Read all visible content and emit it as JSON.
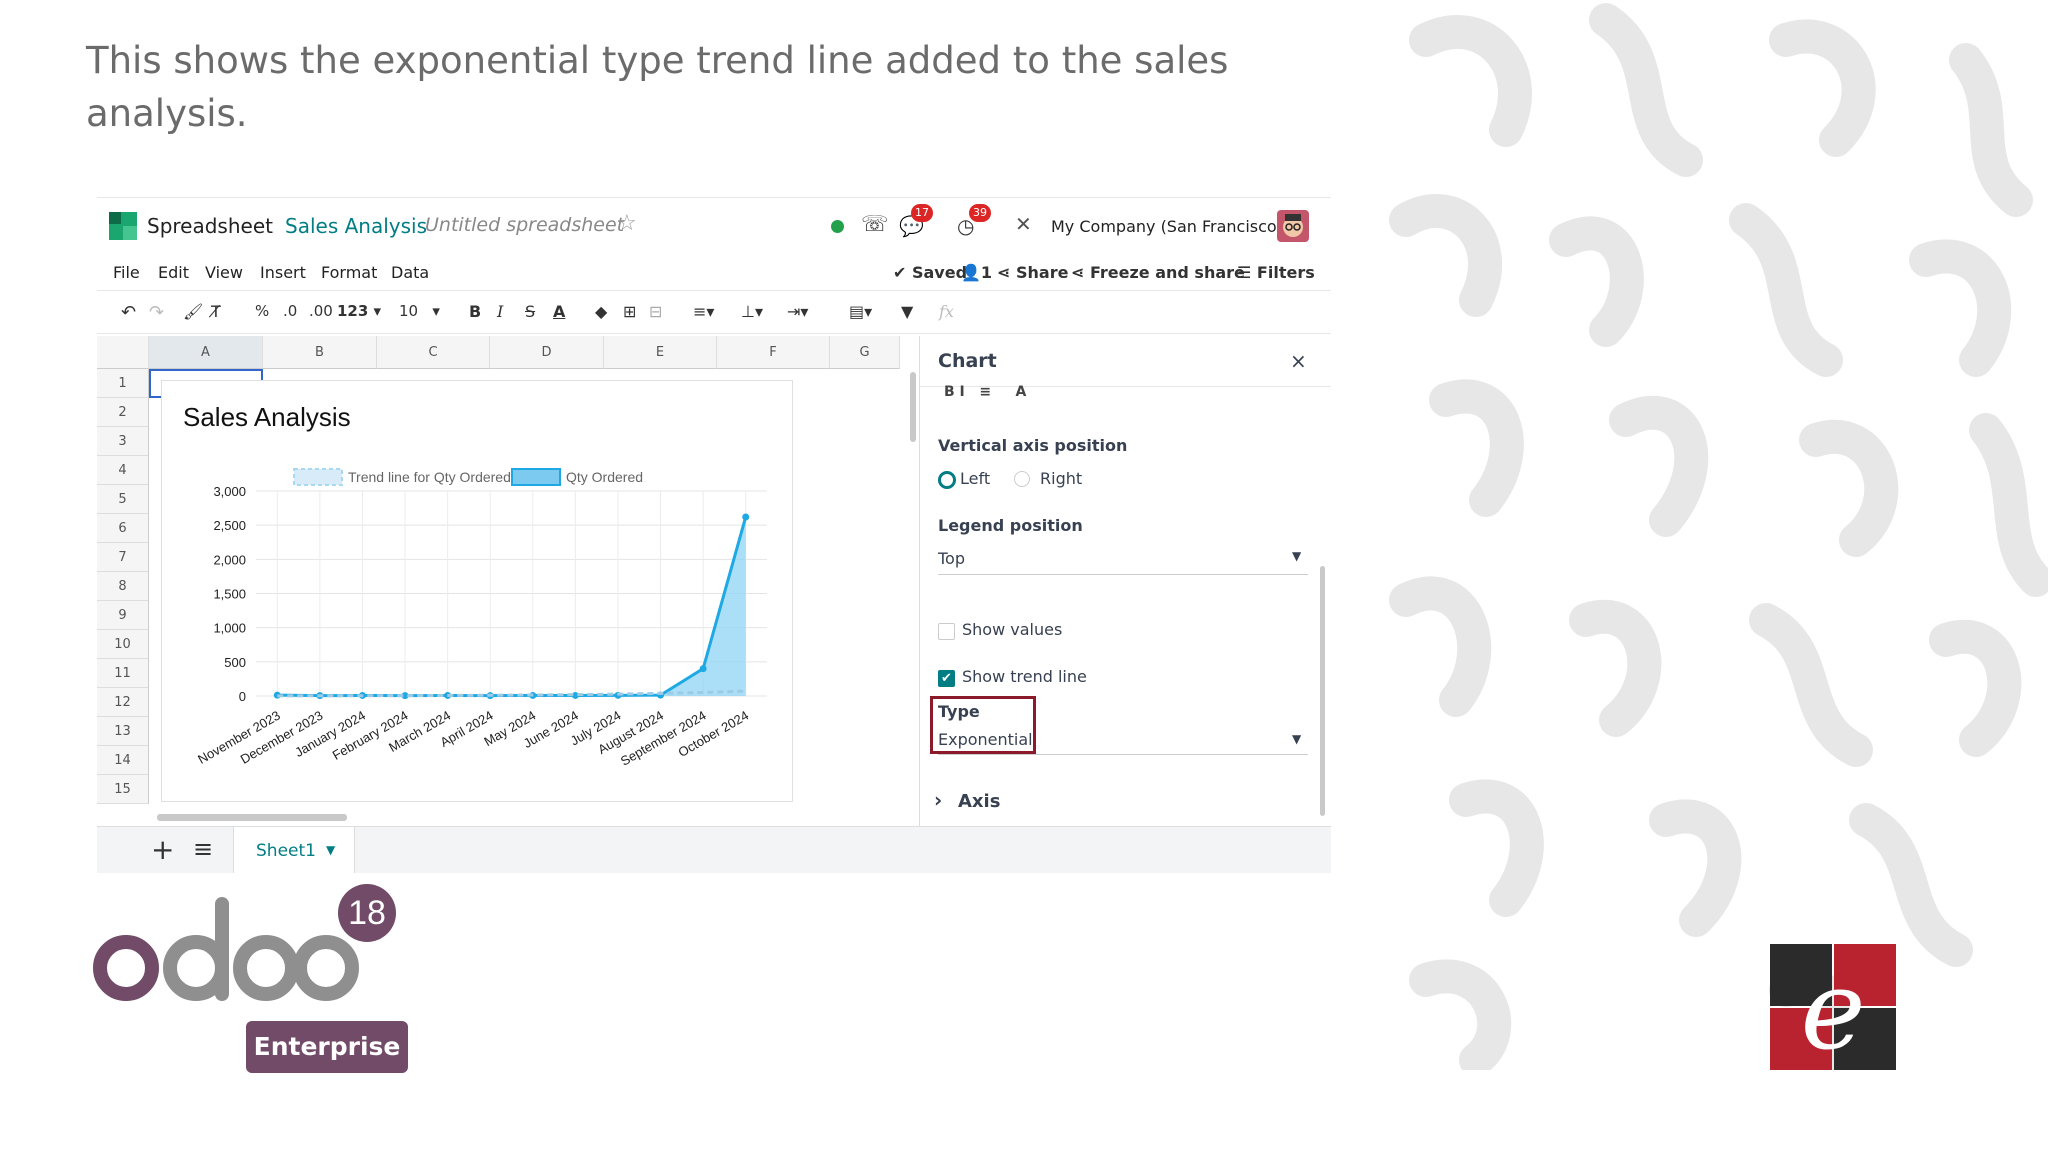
{
  "slide": {
    "title": "This shows the  exponential type trend line added to the sales analysis."
  },
  "app": {
    "app_name": "Spreadsheet",
    "breadcrumb": "Sales Analysis",
    "doc_name": "Untitled spreadsheet",
    "messages_count": "17",
    "activities_count": "39",
    "company": "My Company (San Francisco)",
    "menu": [
      "File",
      "Edit",
      "View",
      "Insert",
      "Format",
      "Data"
    ],
    "saved_label": "Saved",
    "users_count": "1",
    "share_label": "Share",
    "freeze_share_label": "Freeze and share",
    "filters_label": "Filters",
    "toolbar": {
      "percent": "%",
      "dec_less": ".0",
      "dec_more": ".00",
      "number_format": "123",
      "font_size": "10",
      "bold": "B",
      "italic": "I",
      "strike": "S",
      "text_color": "A",
      "formula_placeholder": "fx"
    },
    "columns": [
      "A",
      "B",
      "C",
      "D",
      "E",
      "F",
      "G"
    ],
    "rows": [
      "1",
      "2",
      "3",
      "4",
      "5",
      "6",
      "7",
      "8",
      "9",
      "10",
      "11",
      "12",
      "13",
      "14",
      "15"
    ],
    "sheet_tab": "Sheet1",
    "accent": "#017e84"
  },
  "panel": {
    "title": "Chart",
    "vertical_axis_label": "Vertical axis position",
    "left_label": "Left",
    "right_label": "Right",
    "legend_label": "Legend position",
    "legend_value": "Top",
    "show_values_label": "Show values",
    "show_trend_label": "Show trend line",
    "type_label": "Type",
    "type_value": "Exponential",
    "axis_label": "Axis"
  },
  "chart_data": {
    "type": "line",
    "title": "Sales Analysis",
    "categories": [
      "November 2023",
      "December 2023",
      "January 2024",
      "February 2024",
      "March 2024",
      "April 2024",
      "May 2024",
      "June 2024",
      "July 2024",
      "August 2024",
      "September 2024",
      "October 2024"
    ],
    "series": [
      {
        "name": "Trend line for Qty Ordered",
        "values": [
          2,
          3,
          4,
          6,
          8,
          11,
          15,
          20,
          28,
          38,
          52,
          71
        ],
        "style": "dashed",
        "color": "#a9d8f3"
      },
      {
        "name": "Qty Ordered",
        "values": [
          12,
          5,
          8,
          5,
          8,
          6,
          8,
          8,
          10,
          12,
          400,
          2620
        ],
        "style": "area",
        "color": "#1fa9e4"
      }
    ],
    "ylim": [
      0,
      3000
    ],
    "yticks": [
      "3,000",
      "2,500",
      "2,000",
      "1,500",
      "1,000",
      "500",
      "0"
    ],
    "legend": "top",
    "grid": true
  },
  "branding": {
    "version": "18",
    "edition": "Enterprise"
  }
}
